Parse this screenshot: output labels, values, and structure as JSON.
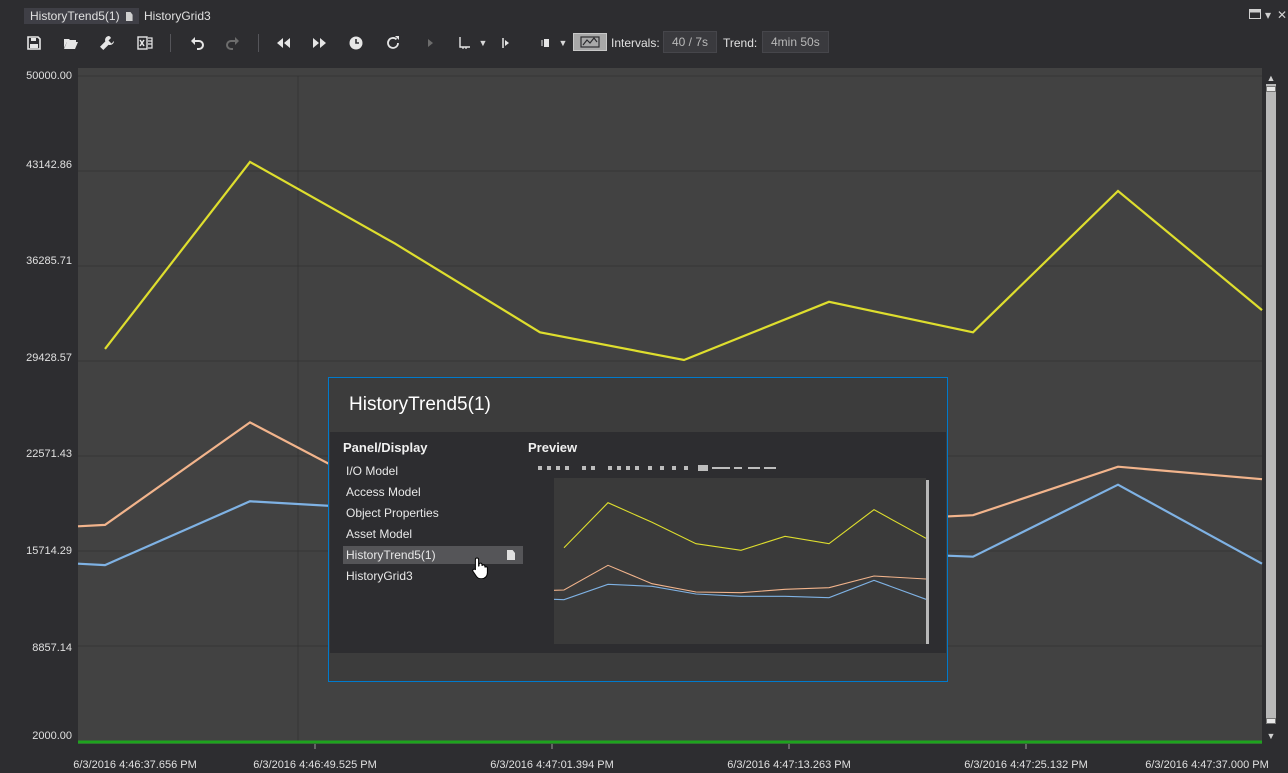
{
  "tabs": [
    {
      "label": "HistoryTrend5(1)",
      "active": true
    },
    {
      "label": "HistoryGrid3",
      "active": false
    }
  ],
  "window_controls": {
    "menu_icon": "window-menu-icon",
    "dropdown": "▾",
    "close": "✕"
  },
  "toolbar": {
    "buttons": [
      "save-icon",
      "open-folder-icon",
      "wrench-icon",
      "excel-export-icon",
      "undo-icon",
      "redo-icon",
      "rewind-icon",
      "fast-forward-icon",
      "clock-icon",
      "refresh-icon",
      "play-icon",
      "axis-icon",
      "start-marker-icon",
      "end-marker-icon",
      "live-mode-toggle-icon"
    ],
    "intervals_label": "Intervals:",
    "intervals_value": "40 / 7s",
    "trend_label": "Trend:",
    "trend_value": "4min 50s"
  },
  "chart_data": {
    "type": "line",
    "y_ticks": [
      "50000.00",
      "43142.86",
      "36285.71",
      "29428.57",
      "22571.43",
      "15714.29",
      "8857.14",
      "2000.00"
    ],
    "ylim": [
      2000,
      50000
    ],
    "x_ticks": [
      "6/3/2016 4:46:37.656 PM",
      "6/3/2016 4:46:49.525 PM",
      "6/3/2016 4:47:01.394 PM",
      "6/3/2016 4:47:13.263 PM",
      "6/3/2016 4:47:25.132 PM",
      "6/3/2016 4:47:37.000 PM"
    ],
    "x": [
      "4:46:37.656",
      "4:46:39.2",
      "4:46:46.5",
      "4:46:53.7",
      "4:47:00.9",
      "4:47:08.2",
      "4:47:15.4",
      "4:47:22.6",
      "4:47:29.8",
      "4:47:37.0"
    ],
    "series": [
      {
        "color": "#dede2e",
        "values": [
          null,
          30300,
          43800,
          37900,
          31500,
          29500,
          33700,
          31500,
          41700,
          33100
        ]
      },
      {
        "color": "#f2b48c",
        "values": [
          17500,
          17600,
          25000,
          19500,
          17000,
          16800,
          17800,
          18300,
          21800,
          20900
        ]
      },
      {
        "color": "#7fb2e4",
        "values": [
          14800,
          14700,
          19300,
          18700,
          16400,
          15700,
          15700,
          15300,
          20500,
          14800
        ]
      }
    ],
    "baseline_color": "#1ea31e",
    "grid": true
  },
  "switcher": {
    "title": "HistoryTrend5(1)",
    "panel_heading": "Panel/Display",
    "preview_heading": "Preview",
    "items": [
      "I/O Model",
      "Access Model",
      "Object Properties",
      "Asset Model",
      "HistoryTrend5(1)",
      "HistoryGrid3"
    ],
    "selected_index": 4
  }
}
